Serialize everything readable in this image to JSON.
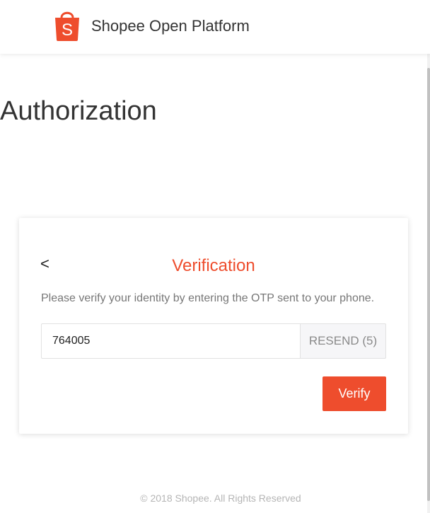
{
  "header": {
    "logo_icon": "shopee-bag-icon",
    "logo_letter": "S",
    "brand": "Shopee Open Platform",
    "brand_color": "#ee4d2d"
  },
  "page": {
    "title": "Authorization"
  },
  "verification": {
    "back_label": "<",
    "title": "Verification",
    "instruction": "Please verify your identity by entering the OTP sent to your phone.",
    "otp_value": "764005",
    "resend_label": "RESEND (5)",
    "verify_label": "Verify",
    "accent_color": "#ee4d2d"
  },
  "footer": {
    "copyright": "© 2018 Shopee. All Rights Reserved"
  }
}
